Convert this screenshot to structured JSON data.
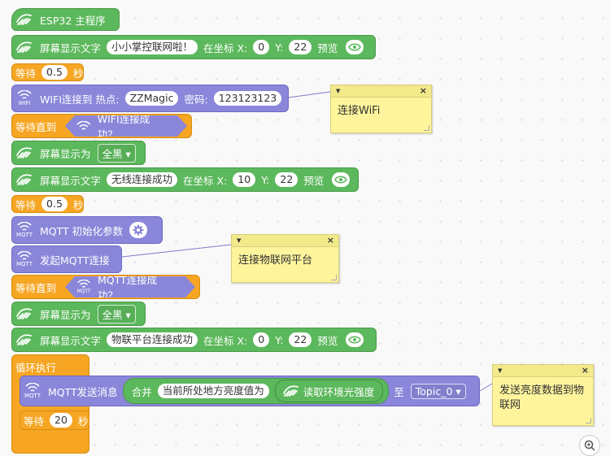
{
  "main": {
    "label": "ESP32 主程序"
  },
  "b1": {
    "label": "屏幕显示文字",
    "text": "小小掌控联网啦！",
    "at": "在坐标 X:",
    "x": "0",
    "ylabel": "Y:",
    "y": "22",
    "preview": "预览"
  },
  "wait1": {
    "label": "等待",
    "value": "0.5",
    "unit": "秒"
  },
  "wifi": {
    "label": "WIFI连接到 热点:",
    "ssid": "ZZMagic",
    "pwd_label": "密码:",
    "pwd": "123123123",
    "icon_label": "WIFI"
  },
  "waitwifi": {
    "label": "等待直到",
    "cond": "WIFI连接成功？"
  },
  "disp": {
    "label": "屏幕显示为",
    "value": "全黑"
  },
  "b2": {
    "label": "屏幕显示文字",
    "text": "无线连接成功",
    "at": "在坐标 X:",
    "x": "10",
    "ylabel": "Y:",
    "y": "22",
    "preview": "预览"
  },
  "wait2": {
    "label": "等待",
    "value": "0.5",
    "unit": "秒"
  },
  "mqttinit": {
    "label": "MQTT 初始化参数",
    "icon_label": "MQTT"
  },
  "mqttconn": {
    "label": "发起MQTT连接"
  },
  "waitmqtt": {
    "label": "等待直到",
    "cond": "MQTT连接成功？"
  },
  "disp2": {
    "label": "屏幕显示为",
    "value": "全黑"
  },
  "b3": {
    "label": "屏幕显示文字",
    "text": "物联平台连接成功",
    "at": "在坐标 X:",
    "x": "0",
    "ylabel": "Y:",
    "y": "22",
    "preview": "预览"
  },
  "loop": {
    "label": "循环执行"
  },
  "send": {
    "label": "MQTT发送消息",
    "merge": "合并",
    "text": "当前所处地方亮度值为",
    "sensor": "读取环境光强度",
    "to": "至",
    "topic": "Topic_0"
  },
  "wait3": {
    "label": "等待",
    "value": "20",
    "unit": "秒"
  },
  "comments": {
    "c1": "连接WiFi",
    "c2": "连接物联网平台",
    "c3": "发送亮度数据到物联网"
  },
  "colors": {
    "green": "#5cb85c",
    "orange": "#f6a623",
    "purple": "#8a86d9",
    "comment": "#fef49c"
  }
}
